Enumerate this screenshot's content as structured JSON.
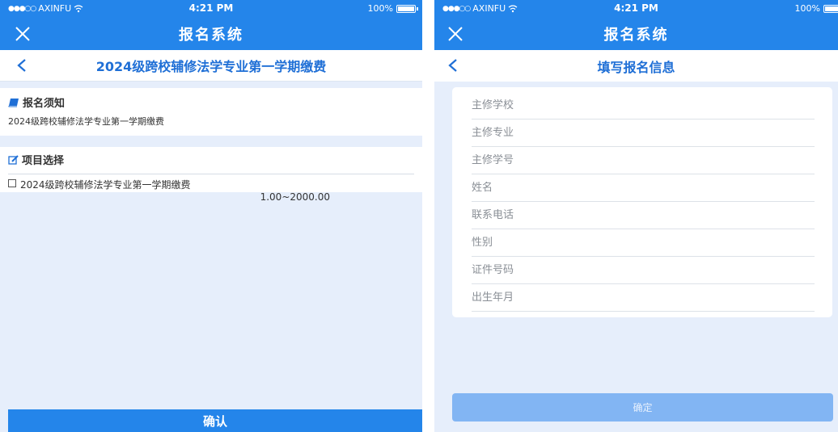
{
  "status_bar": {
    "carrier": "AXINFU",
    "signal_dots": "●●●○○",
    "wifi_icon": "wifi-icon",
    "time": "4:21 PM",
    "battery": "100%"
  },
  "colors": {
    "primary": "#2485ea",
    "background": "#e6eefb",
    "subtitle": "#1f6fd6",
    "disabled_button": "#82b5f3"
  },
  "left_screen": {
    "nav_title": "报名系统",
    "page_title": "2024级跨校辅修法学专业第一学期缴费",
    "notice": {
      "title": "报名须知",
      "text": "2024级跨校辅修法学专业第一学期缴费"
    },
    "project": {
      "title": "项目选择",
      "item_label": "2024级跨校辅修法学专业第一学期缴费",
      "item_range": "1.00~2000.00"
    },
    "confirm_button": "确认"
  },
  "right_screen": {
    "nav_title": "报名系统",
    "page_title": "填写报名信息",
    "fields": [
      "主修学校",
      "主修专业",
      "主修学号",
      "姓名",
      "联系电话",
      "性别",
      "证件号码",
      "出生年月"
    ],
    "confirm_button": "确定"
  }
}
